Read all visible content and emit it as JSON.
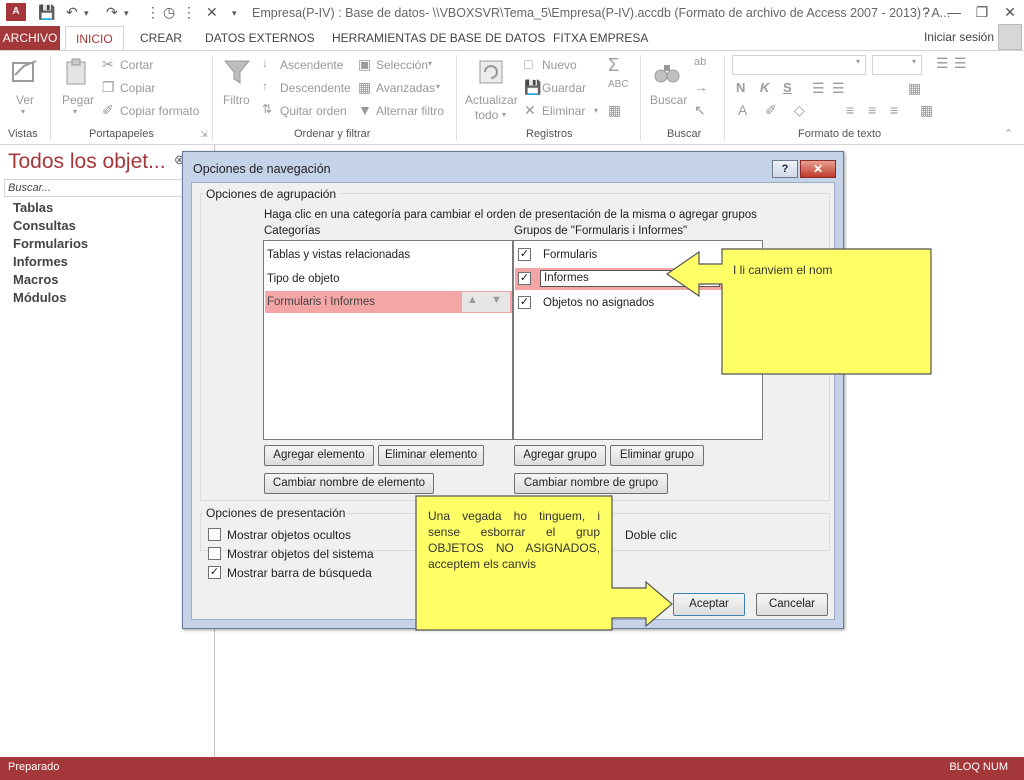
{
  "titlebar": {
    "app_icon": "A",
    "title": "Empresa(P-IV) : Base de datos- \\\\VBOXSVR\\Tema_5\\Empresa(P-IV).accdb (Formato de archivo de Access 2007 - 2013) - A..."
  },
  "tabs": {
    "file": "ARCHIVO",
    "items": [
      "INICIO",
      "CREAR",
      "DATOS EXTERNOS",
      "HERRAMIENTAS DE BASE DE DATOS",
      "FITXA EMPRESA"
    ],
    "login": "Iniciar sesión"
  },
  "ribbon": {
    "vistas": {
      "ver": "Ver",
      "label": "Vistas"
    },
    "portapapeles": {
      "pegar": "Pegar",
      "cortar": "Cortar",
      "copiar": "Copiar",
      "copiar_formato": "Copiar formato",
      "label": "Portapapeles"
    },
    "ordenar": {
      "filtro": "Filtro",
      "ascendente": "Ascendente",
      "descendente": "Descendente",
      "quitar_orden": "Quitar orden",
      "seleccion": "Selección",
      "avanzadas": "Avanzadas",
      "alternar_filtro": "Alternar filtro",
      "label": "Ordenar y filtrar"
    },
    "registros": {
      "actualizar": "Actualizar",
      "todo": "todo",
      "nuevo": "Nuevo",
      "guardar": "Guardar",
      "eliminar": "Eliminar",
      "label": "Registros"
    },
    "buscar": {
      "buscar": "Buscar",
      "label": "Buscar"
    },
    "formato": {
      "label": "Formato de texto",
      "bold": "N",
      "italic": "K",
      "underline": "S"
    }
  },
  "navpane": {
    "title": "Todos los objet...",
    "search_placeholder": "Buscar...",
    "items": [
      "Tablas",
      "Consultas",
      "Formularios",
      "Informes",
      "Macros",
      "Módulos"
    ]
  },
  "dialog": {
    "title": "Opciones de navegación",
    "help": "?",
    "close": "✕",
    "grouping": {
      "legend": "Opciones de agrupación",
      "hint": "Haga clic en una categoría para cambiar el orden de presentación de la misma o agregar grupos",
      "categories_label": "Categorías",
      "groups_label": "Grupos de \"Formularis i Informes\"",
      "categories": [
        "Tablas y vistas relacionadas",
        "Tipo de objeto",
        "Formularis i Informes"
      ],
      "groups": [
        {
          "label": "Formularis",
          "checked": true
        },
        {
          "label": "Informes",
          "checked": true
        },
        {
          "label": "Objetos no asignados",
          "checked": true
        }
      ],
      "btn_add_item": "Agregar elemento",
      "btn_delete_item": "Eliminar elemento",
      "btn_rename_item": "Cambiar nombre de elemento",
      "btn_add_group": "Agregar grupo",
      "btn_delete_group": "Eliminar grupo",
      "btn_rename_group": "Cambiar nombre de grupo"
    },
    "presentation": {
      "legend": "Opciones de presentación",
      "show_hidden": "Mostrar objetos ocultos",
      "show_system": "Mostrar objetos del sistema",
      "show_search": "Mostrar barra de búsqueda",
      "show_hidden_checked": false,
      "show_system_checked": false,
      "show_search_checked": true,
      "double_click": "Doble clic"
    },
    "ok": "Aceptar",
    "cancel": "Cancelar"
  },
  "callouts": {
    "rename": "I li canviem el nom",
    "accept": "Una vegada ho tinguem, i sense esborrar el grup OBJETOS NO ASIGNADOS, acceptem els canvis"
  },
  "statusbar": {
    "left": "Preparado",
    "right": "BLOQ NUM"
  },
  "colors": {
    "accent": "#a4373a",
    "callout": "#ffff66",
    "selected_row": "#f4a6a6"
  }
}
